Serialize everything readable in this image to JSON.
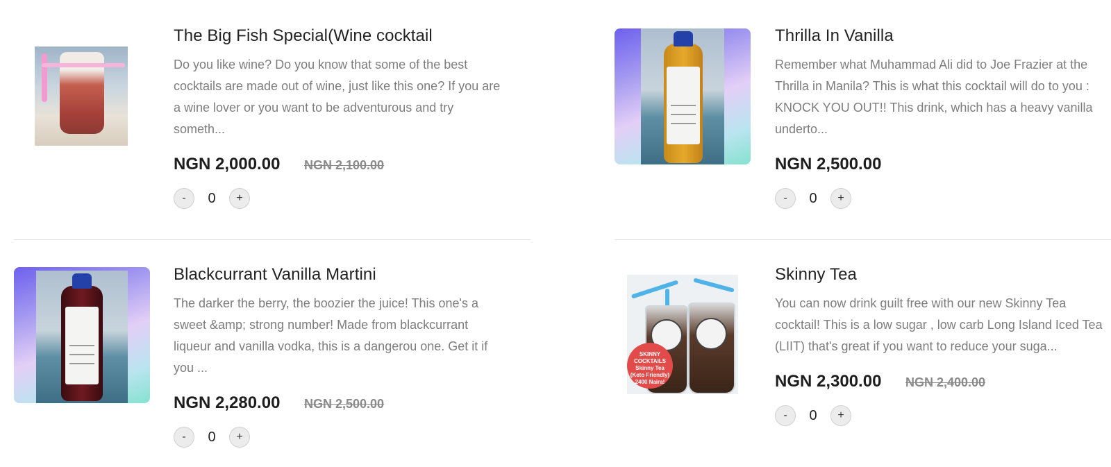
{
  "currency_note": "NGN",
  "products": [
    {
      "title": "The Big Fish Special(Wine cocktail",
      "description": "Do you like wine? Do you know that some of the best cocktails are made out of wine, just like this one? If you are a wine lover or you want to be adventurous and try someth...",
      "price": "NGN 2,000.00",
      "old_price": "NGN 2,100.00",
      "quantity": "0",
      "minus_label": "-",
      "plus_label": "+",
      "image": "wine-pouch-cocktail-photo"
    },
    {
      "title": "Thrilla In Vanilla",
      "description": "Remember what Muhammad Ali did to Joe Frazier at the Thrilla in Manila? This is what this cocktail will do to you : KNOCK YOU OUT!! This drink, which has a heavy vanilla underto...",
      "price": "NGN 2,500.00",
      "old_price": "",
      "quantity": "0",
      "minus_label": "-",
      "plus_label": "+",
      "image": "vanilla-bottle-photo"
    },
    {
      "title": "Blackcurrant Vanilla Martini",
      "description": "The darker the berry, the boozier the juice! This one's a sweet &amp; strong number! Made from blackcurrant liqueur and vanilla vodka, this is a dangerou one. Get it if you ...",
      "price": "NGN 2,280.00",
      "old_price": "NGN 2,500.00",
      "quantity": "0",
      "minus_label": "-",
      "plus_label": "+",
      "image": "blackcurrant-bottle-photo"
    },
    {
      "title": "Skinny Tea",
      "description": "You can now drink guilt free with our new Skinny Tea cocktail! This is a low sugar , low carb Long Island Iced Tea (LIIT) that's great if you want to reduce your suga...",
      "price": "NGN 2,300.00",
      "old_price": "NGN 2,400.00",
      "quantity": "0",
      "minus_label": "-",
      "plus_label": "+",
      "image": "skinny-tea-cups-photo",
      "image_badge": [
        "SKINNY",
        "COCKTAILS",
        "Skinny Tea",
        "(Keto Friendly)",
        "2400 Naira!"
      ]
    }
  ],
  "colors": {
    "title": "#222222",
    "description": "#7d7d7d",
    "price": "#1e1e1e",
    "old_price": "#8a8a8a",
    "divider": "#dcdcdc"
  }
}
